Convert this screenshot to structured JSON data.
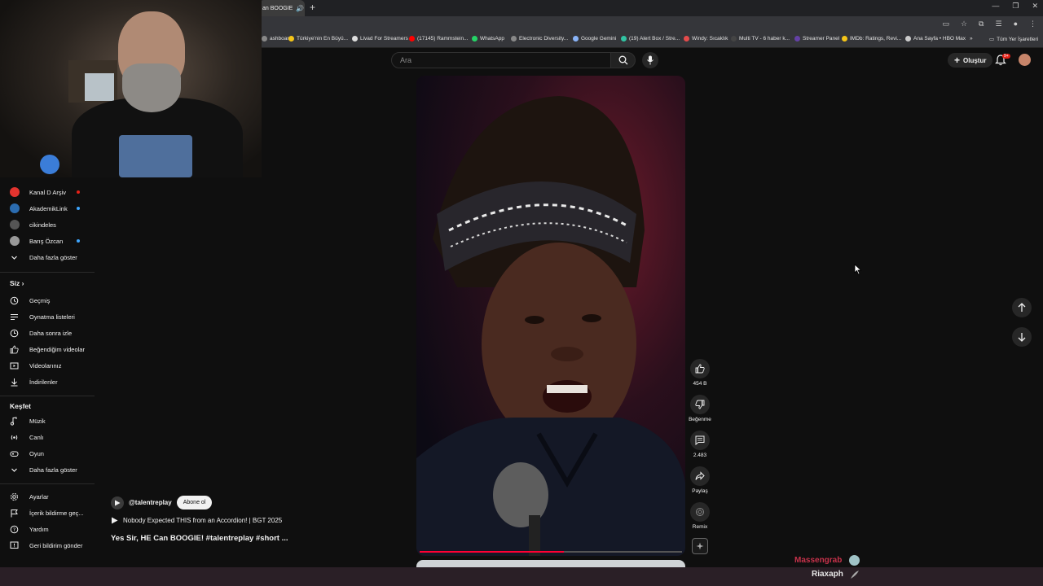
{
  "browser": {
    "tab_title": "an BOOGIE",
    "bookmarks": [
      {
        "label": "ashboard",
        "color": "#888888"
      },
      {
        "label": "Türkiye'nin En Büyü...",
        "color": "#f5c518"
      },
      {
        "label": "Livad For Streamers",
        "color": "#dddddd"
      },
      {
        "label": "(17145) Rammstein...",
        "color": "#ff0000"
      },
      {
        "label": "WhatsApp",
        "color": "#25d366"
      },
      {
        "label": "Electronic Diversity...",
        "color": "#888888"
      },
      {
        "label": "Google Gemini",
        "color": "#8ab4f8"
      },
      {
        "label": "(19) Alert Box / Stre...",
        "color": "#31c3a2"
      },
      {
        "label": "Windy: Sıcaklık",
        "color": "#e44b4b"
      },
      {
        "label": "Multi TV - 6 haber k...",
        "color": "#444444"
      },
      {
        "label": "Streamer Panel",
        "color": "#6441a5"
      },
      {
        "label": "IMDb: Ratings, Revi...",
        "color": "#f5c518"
      },
      {
        "label": "Ana Sayfa • HBO Max",
        "color": "#cccccc"
      }
    ],
    "all_bookmarks": "Tüm Yer İşaretleri"
  },
  "header": {
    "search_placeholder": "Ara",
    "create_label": "Oluştur",
    "notif_count": "9+"
  },
  "sidebar": {
    "channels": [
      {
        "label": "Kanal D Arşiv",
        "color": "#e3342f",
        "live_color": "#e62117"
      },
      {
        "label": "AkademikLink",
        "color": "#2b6cb0",
        "live_color": "#3ea6ff"
      },
      {
        "label": "cikindeles",
        "color": "#555555",
        "live_color": ""
      },
      {
        "label": "Barış Özcan",
        "color": "#999999",
        "live_color": "#3ea6ff"
      }
    ],
    "show_more_1": "Daha fazla göster",
    "you_header": "Siz",
    "you_items": [
      "Geçmiş",
      "Oynatma listeleri",
      "Daha sonra izle",
      "Beğendiğim videolar",
      "Videolarınız",
      "İndirilenler"
    ],
    "explore_header": "Keşfet",
    "explore_items": [
      "Müzik",
      "Canlı",
      "Oyun"
    ],
    "show_more_2": "Daha fazla göster",
    "bottom_items": [
      "Ayarlar",
      "İçerik bildirme geç...",
      "Yardım",
      "Geri bildirim gönder"
    ]
  },
  "short": {
    "channel": "@talentreplay",
    "subscribe": "Abone ol",
    "music": "Nobody Expected THIS from an Accordion! | BGT 2025",
    "title": "Yes Sir, HE Can BOOGIE! #talentreplay #short ...",
    "likes": "454 B",
    "dislike_label": "Beğenme",
    "comments": "2.483",
    "share_label": "Paylaş",
    "remix_label": "Remix",
    "progress": 0.55
  },
  "overlay": {
    "red_name": "Massengrab",
    "white_name": "Riaxaph"
  }
}
